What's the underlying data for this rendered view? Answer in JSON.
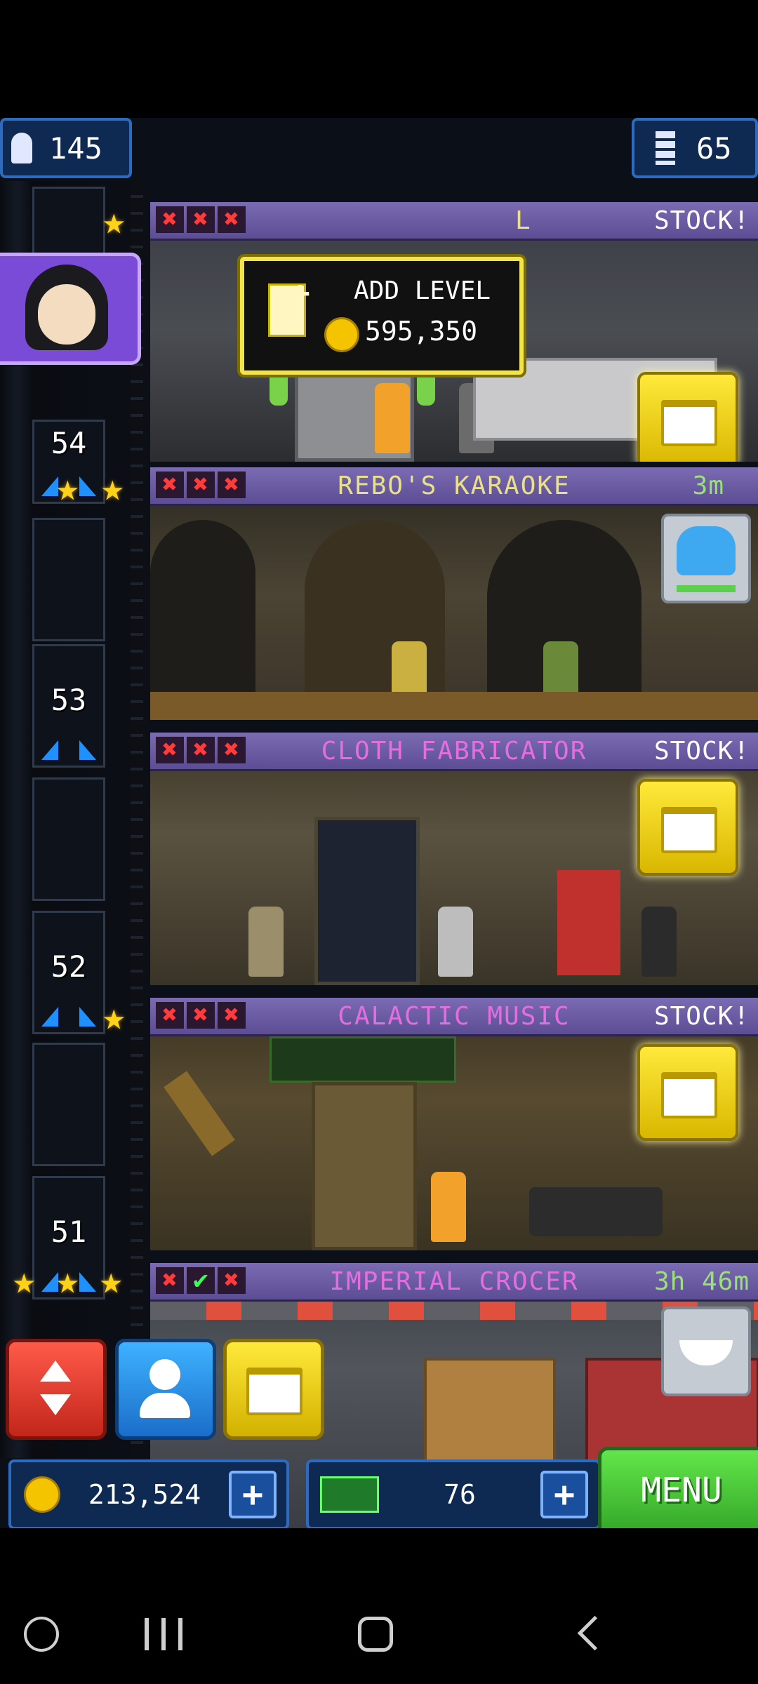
{
  "hud": {
    "population": "145",
    "floors": "65",
    "coins": "213,524",
    "bux": "76",
    "menu_label": "MENU"
  },
  "add_level": {
    "label": "ADD LEVEL",
    "cost": "595,350"
  },
  "shaft": {
    "floor_numbers": [
      "54",
      "53",
      "52",
      "51"
    ]
  },
  "floors": [
    {
      "name": "L",
      "status": "STOCK!",
      "marks": [
        "x",
        "x",
        "x"
      ]
    },
    {
      "name": "REBO'S KARAOKE",
      "status": "3m",
      "marks": [
        "x",
        "x",
        "x"
      ]
    },
    {
      "name": "CLOTH FABRICATOR",
      "status": "STOCK!",
      "marks": [
        "x",
        "x",
        "x"
      ]
    },
    {
      "name": "CALACTIC MUSIC",
      "status": "STOCK!",
      "marks": [
        "x",
        "x",
        "x"
      ]
    },
    {
      "name": "IMPERIAL CROCER",
      "status": "3h 46m",
      "marks": [
        "x",
        "check",
        "x"
      ]
    }
  ],
  "colors": {
    "floor_bar": "#6f5fb0",
    "name_karaoke": "#e8e08a",
    "name_pink": "#e46ee0",
    "timer_green": "#9be07a",
    "stock_yellow": "#f0dd20",
    "menu_green": "#4fd23a"
  },
  "icons": {
    "population": "person-icon",
    "floors": "building-icon",
    "add_level": "add-floor-icon",
    "elevator": "elevator-arrows-icon",
    "bitizens": "person-icon",
    "stock": "crate-icon",
    "coin": "coin-icon",
    "bux": "bux-icon"
  }
}
